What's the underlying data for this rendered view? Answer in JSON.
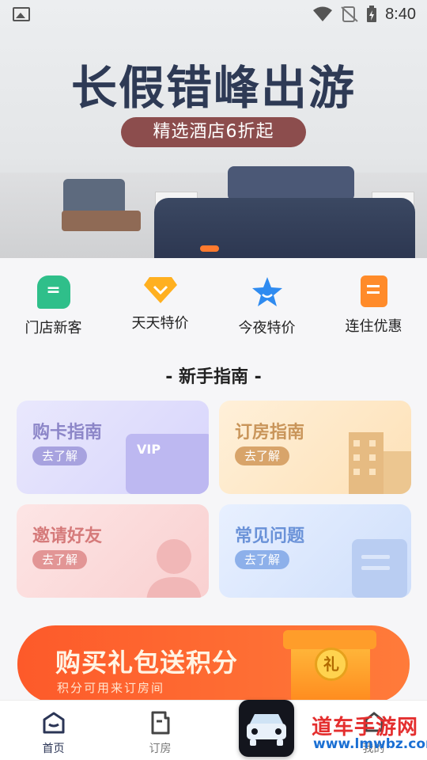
{
  "status_bar": {
    "time": "8:40"
  },
  "banner": {
    "headline": "长假错峰出游",
    "tagline": "精选酒店6折起"
  },
  "quick_nav": [
    {
      "label": "门店新客",
      "icon": "store-icon",
      "color": "#2fbf8a"
    },
    {
      "label": "天天特价",
      "icon": "diamond-icon",
      "color": "#ffb020"
    },
    {
      "label": "今夜特价",
      "icon": "star-icon",
      "color": "#2f8bf0"
    },
    {
      "label": "连住优惠",
      "icon": "document-icon",
      "color": "#ff8b2a"
    }
  ],
  "guide": {
    "title": "- 新手指南 -",
    "cards": [
      {
        "title": "购卡指南",
        "button": "去了解",
        "art": "VIP"
      },
      {
        "title": "订房指南",
        "button": "去了解"
      },
      {
        "title": "邀请好友",
        "button": "去了解"
      },
      {
        "title": "常见问题",
        "button": "去了解"
      }
    ]
  },
  "promo": {
    "title": "购买礼包送积分",
    "subtitle": "积分可用来订房间",
    "coin": "礼"
  },
  "tabbar": {
    "tabs": [
      {
        "label": "首页",
        "active": true
      },
      {
        "label": "订房",
        "active": false
      },
      {
        "label": "",
        "active": false
      },
      {
        "label": "我的",
        "active": false
      }
    ]
  },
  "watermark": {
    "line1": "道车手游网",
    "line2": "www.lmwbz.com"
  }
}
